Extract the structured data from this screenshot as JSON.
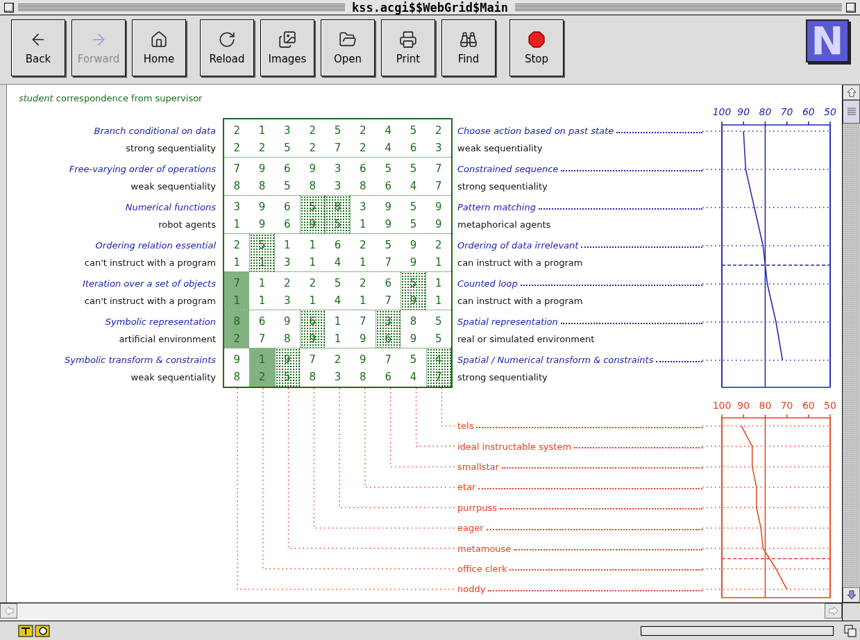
{
  "window": {
    "title": "kss.acgi$$WebGrid$Main"
  },
  "toolbar": {
    "groups": [
      [
        {
          "label": "Back",
          "kind": "back",
          "disabled": false
        },
        {
          "label": "Forward",
          "kind": "forward",
          "disabled": true
        },
        {
          "label": "Home",
          "kind": "home",
          "disabled": false
        }
      ],
      [
        {
          "label": "Reload",
          "kind": "reload",
          "disabled": false
        },
        {
          "label": "Images",
          "kind": "images",
          "disabled": false
        },
        {
          "label": "Open",
          "kind": "open",
          "disabled": false
        },
        {
          "label": "Print",
          "kind": "print",
          "disabled": false
        },
        {
          "label": "Find",
          "kind": "find",
          "disabled": false
        }
      ],
      [
        {
          "label": "Stop",
          "kind": "stop",
          "disabled": false
        }
      ]
    ],
    "logo": {
      "text": "N"
    }
  },
  "grid": {
    "heading": "*student* correspondence from supervisor",
    "pairs": [
      {
        "cut": false,
        "rows": [
          {
            "kind": "emergent",
            "left": "Branch conditional on data",
            "ratings": [
              "2",
              "1",
              "3",
              "2",
              "5",
              "2",
              "4",
              "5",
              "2"
            ],
            "right": "Choose action based on past state"
          },
          {
            "kind": "implicit",
            "left": "strong sequentiality",
            "ratings": [
              "2",
              "2",
              "5",
              "2",
              "7",
              "2",
              "4",
              "6",
              "3"
            ],
            "right": "weak sequentiality"
          }
        ],
        "columns": [
          {
            "kind": "plain"
          },
          {
            "kind": "plain"
          },
          {
            "kind": "plain"
          },
          {
            "kind": "plain"
          },
          {
            "kind": "plain"
          },
          {
            "kind": "plain"
          },
          {
            "kind": "plain"
          },
          {
            "kind": "plain"
          },
          {
            "kind": "plain"
          }
        ]
      },
      {
        "cut": false,
        "rows": [
          {
            "kind": "emergent",
            "left": "Free-varying order of operations",
            "ratings": [
              "7",
              "9",
              "6",
              "9",
              "3",
              "6",
              "5",
              "5",
              "7"
            ],
            "right": "Constrained sequence"
          },
          {
            "kind": "implicit",
            "left": "weak sequentiality",
            "ratings": [
              "8",
              "8",
              "5",
              "8",
              "3",
              "8",
              "6",
              "4",
              "7"
            ],
            "right": "strong sequentiality"
          }
        ],
        "columns": [
          {
            "kind": "plain"
          },
          {
            "kind": "plain"
          },
          {
            "kind": "plain"
          },
          {
            "kind": "plain"
          },
          {
            "kind": "plain"
          },
          {
            "kind": "plain"
          },
          {
            "kind": "plain"
          },
          {
            "kind": "plain"
          },
          {
            "kind": "plain"
          }
        ]
      },
      {
        "cut": false,
        "rows": [
          {
            "kind": "emergent",
            "left": "Numerical functions",
            "ratings": [
              "3",
              "9",
              "6",
              "5",
              "8",
              "3",
              "9",
              "5",
              "9"
            ],
            "right": "Pattern matching"
          },
          {
            "kind": "implicit",
            "left": "robot agents",
            "ratings": [
              "1",
              "9",
              "6",
              "9",
              "5",
              "1",
              "9",
              "5",
              "9"
            ],
            "right": "metaphorical agents"
          }
        ],
        "columns": [
          {
            "kind": "plain"
          },
          {
            "kind": "plain"
          },
          {
            "kind": "plain"
          },
          {
            "kind": "light"
          },
          {
            "kind": "light"
          },
          {
            "kind": "plain"
          },
          {
            "kind": "plain"
          },
          {
            "kind": "plain"
          },
          {
            "kind": "plain"
          }
        ]
      },
      {
        "cut": true,
        "rows": [
          {
            "kind": "emergent",
            "left": "Ordering relation essential",
            "ratings": [
              "2",
              "5",
              "1",
              "1",
              "6",
              "2",
              "5",
              "9",
              "2"
            ],
            "right": "Ordering of data irrelevant"
          },
          {
            "kind": "implicit",
            "left": "can't instruct with a program",
            "ratings": [
              "1",
              "1",
              "3",
              "1",
              "4",
              "1",
              "7",
              "9",
              "1"
            ],
            "right": "can instruct with a program"
          }
        ],
        "columns": [
          {
            "kind": "plain"
          },
          {
            "kind": "light"
          },
          {
            "kind": "plain"
          },
          {
            "kind": "plain"
          },
          {
            "kind": "plain"
          },
          {
            "kind": "plain"
          },
          {
            "kind": "plain"
          },
          {
            "kind": "plain"
          },
          {
            "kind": "plain"
          }
        ]
      },
      {
        "cut": false,
        "rows": [
          {
            "kind": "emergent",
            "left": "Iteration over a set of objects",
            "ratings": [
              "7",
              "1",
              "2",
              "2",
              "5",
              "2",
              "6",
              "5",
              "1"
            ],
            "right": "Counted loop"
          },
          {
            "kind": "implicit",
            "left": "can't instruct with a program",
            "ratings": [
              "1",
              "1",
              "3",
              "1",
              "4",
              "1",
              "7",
              "9",
              "1"
            ],
            "right": "can instruct with a program"
          }
        ],
        "columns": [
          {
            "kind": "dark"
          },
          {
            "kind": "plain"
          },
          {
            "kind": "plain"
          },
          {
            "kind": "plain"
          },
          {
            "kind": "plain"
          },
          {
            "kind": "plain"
          },
          {
            "kind": "plain"
          },
          {
            "kind": "light"
          },
          {
            "kind": "plain"
          }
        ]
      },
      {
        "cut": false,
        "rows": [
          {
            "kind": "emergent",
            "left": "Symbolic representation",
            "ratings": [
              "8",
              "6",
              "9",
              "6",
              "1",
              "7",
              "3",
              "8",
              "5"
            ],
            "right": "Spatial representation"
          },
          {
            "kind": "implicit",
            "left": "artificial environment",
            "ratings": [
              "2",
              "7",
              "8",
              "9",
              "1",
              "9",
              "6",
              "9",
              "5"
            ],
            "right": "real or simulated environment"
          }
        ],
        "columns": [
          {
            "kind": "dark"
          },
          {
            "kind": "plain"
          },
          {
            "kind": "plain"
          },
          {
            "kind": "light"
          },
          {
            "kind": "plain"
          },
          {
            "kind": "plain"
          },
          {
            "kind": "light"
          },
          {
            "kind": "plain"
          },
          {
            "kind": "plain"
          }
        ]
      },
      {
        "cut": false,
        "rows": [
          {
            "kind": "emergent",
            "left": "Symbolic transform & constraints",
            "ratings": [
              "9",
              "1",
              "9",
              "7",
              "2",
              "9",
              "7",
              "5",
              "4"
            ],
            "right": "Spatial / Numerical transform & constraints"
          },
          {
            "kind": "implicit",
            "left": "weak sequentiality",
            "ratings": [
              "8",
              "2",
              "5",
              "8",
              "3",
              "8",
              "6",
              "4",
              "7"
            ],
            "right": "strong sequentiality"
          }
        ],
        "columns": [
          {
            "kind": "plain"
          },
          {
            "kind": "dark"
          },
          {
            "kind": "light"
          },
          {
            "kind": "plain"
          },
          {
            "kind": "plain"
          },
          {
            "kind": "plain"
          },
          {
            "kind": "plain"
          },
          {
            "kind": "plain"
          },
          {
            "kind": "light"
          }
        ]
      }
    ],
    "chart_data": {
      "type": "line",
      "orientation": "horizontal",
      "xlim": [
        100,
        50
      ],
      "xticks": [
        100,
        90,
        80,
        70,
        60,
        50
      ],
      "grid": true,
      "series": [
        {
          "color": "#1c22b4",
          "values": [
            90,
            89,
            85,
            81,
            79,
            75,
            72
          ]
        }
      ]
    }
  },
  "elements": {
    "items": [
      {
        "name": "tels",
        "cut": false
      },
      {
        "name": "ideal instructable system",
        "cut": false
      },
      {
        "name": "smallstar",
        "cut": false
      },
      {
        "name": "etar",
        "cut": false
      },
      {
        "name": "purrpuss",
        "cut": false
      },
      {
        "name": "eager",
        "cut": false
      },
      {
        "name": "metamouse",
        "cut": true
      },
      {
        "name": "office clerk",
        "cut": false
      },
      {
        "name": "noddy",
        "cut": false
      }
    ],
    "chart_data": {
      "type": "line",
      "orientation": "horizontal",
      "xlim": [
        100,
        50
      ],
      "xticks": [
        100,
        90,
        80,
        70,
        60,
        50
      ],
      "grid": true,
      "series": [
        {
          "color": "#e8401c",
          "values": [
            91,
            86,
            86,
            84,
            84,
            82,
            81,
            75,
            70
          ]
        }
      ]
    }
  }
}
